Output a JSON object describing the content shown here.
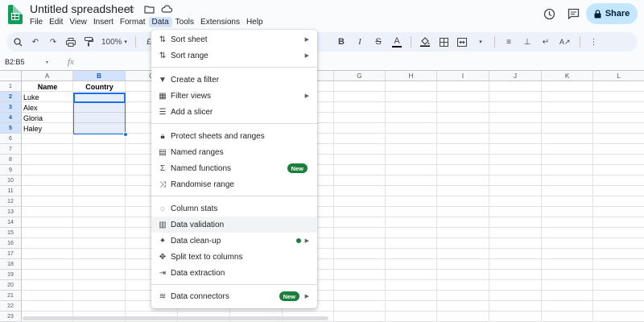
{
  "app": {
    "title": "Untitled spreadsheet",
    "menus": [
      "File",
      "Edit",
      "View",
      "Insert",
      "Format",
      "Data",
      "Tools",
      "Extensions",
      "Help"
    ],
    "active_menu": "Data",
    "share_label": "Share",
    "accent_color": "#0b57d0"
  },
  "toolbar": {
    "zoom": "100%",
    "currency_symbol": "£"
  },
  "formula_bar": {
    "name_box": "B2:B5",
    "fx": "fx"
  },
  "grid": {
    "columns": [
      "A",
      "B",
      "C",
      "D",
      "E",
      "F",
      "G",
      "H",
      "I",
      "J",
      "K",
      "L"
    ],
    "rows": [
      "1",
      "2",
      "3",
      "4",
      "5",
      "6",
      "7",
      "8",
      "9",
      "10",
      "11",
      "12",
      "13",
      "14",
      "15",
      "16",
      "17",
      "18",
      "19",
      "20",
      "21",
      "22",
      "23"
    ],
    "selected_range": "B2:B5",
    "cells": {
      "A1": "Name",
      "B1": "Country",
      "A2": "Luke",
      "A3": "Alex",
      "A4": "Gloria",
      "A5": "Haley"
    }
  },
  "data_menu": {
    "items": [
      {
        "label": "Sort sheet",
        "icon": "sort-icon",
        "submenu": true
      },
      {
        "label": "Sort range",
        "icon": "sort-range-icon",
        "submenu": true
      },
      {
        "label": "Create a filter",
        "icon": "filter-icon"
      },
      {
        "label": "Filter views",
        "icon": "filter-views-icon",
        "submenu": true
      },
      {
        "label": "Add a slicer",
        "icon": "slicer-icon"
      },
      {
        "label": "Protect sheets and ranges",
        "icon": "lock-icon"
      },
      {
        "label": "Named ranges",
        "icon": "named-ranges-icon"
      },
      {
        "label": "Named functions",
        "icon": "sigma-icon",
        "badge": "New"
      },
      {
        "label": "Randomise range",
        "icon": "shuffle-icon"
      },
      {
        "label": "Column stats",
        "icon": "lightbulb-icon"
      },
      {
        "label": "Data validation",
        "icon": "data-validation-icon",
        "highlighted": true
      },
      {
        "label": "Data clean-up",
        "icon": "magic-wand-icon",
        "submenu": true,
        "dot": true
      },
      {
        "label": "Split text to columns",
        "icon": "split-icon"
      },
      {
        "label": "Data extraction",
        "icon": "extraction-icon"
      },
      {
        "label": "Data connectors",
        "icon": "database-icon",
        "badge": "New",
        "submenu": true
      }
    ],
    "badge_color": "#188038"
  }
}
